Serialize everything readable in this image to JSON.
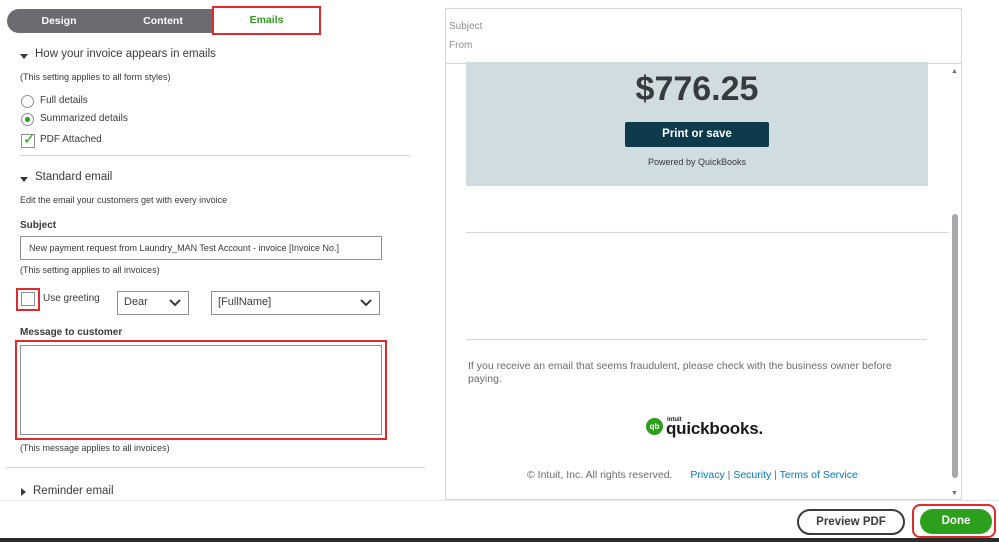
{
  "tabs": [
    {
      "label": "Design"
    },
    {
      "label": "Content"
    },
    {
      "label": "Emails"
    }
  ],
  "invoice_section": {
    "title": "How your invoice appears in emails",
    "note": "(This setting applies to all form styles)",
    "options": [
      {
        "label": "Full details",
        "selected": false
      },
      {
        "label": "Summarized details",
        "selected": true
      }
    ],
    "pdf_attached": {
      "label": "PDF Attached",
      "checked": true
    }
  },
  "standard_email": {
    "title": "Standard email",
    "description": "Edit the email your customers get with every invoice",
    "subject_label": "Subject",
    "subject_value": "New payment request from Laundry_MAN Test Account - invoice [Invoice No.]",
    "subject_note": "(This setting applies to all invoices)",
    "use_greeting": {
      "label": "Use greeting",
      "checked": false
    },
    "greeting_select": "Dear",
    "name_select": "[FullName]",
    "message_label": "Message to customer",
    "message_value": "",
    "message_note": "(This message applies to all invoices)"
  },
  "reminder_email": {
    "title": "Reminder email"
  },
  "preview": {
    "subject_label": "Subject",
    "from_label": "From",
    "amount": "$776.25",
    "print_button": "Print or save",
    "powered_by": "Powered by QuickBooks",
    "fraud_notice": "If you receive an email that seems fraudulent, please check with the business owner before paying.",
    "logo": {
      "badge": "qb",
      "intuit": "intuit",
      "wordmark": "quickbooks."
    },
    "copyright": "© Intuit, Inc. All rights reserved.",
    "links": {
      "privacy": "Privacy",
      "security": "Security",
      "terms": "Terms of Service",
      "separator": "|"
    }
  },
  "footer": {
    "preview_pdf": "Preview PDF",
    "done": "Done"
  },
  "colors": {
    "accent_green": "#2ca01c",
    "highlight_red": "#e12b2b",
    "dark_teal": "#0d3b4c",
    "card_bg": "#d0dde0",
    "link_blue": "#0077c5"
  }
}
